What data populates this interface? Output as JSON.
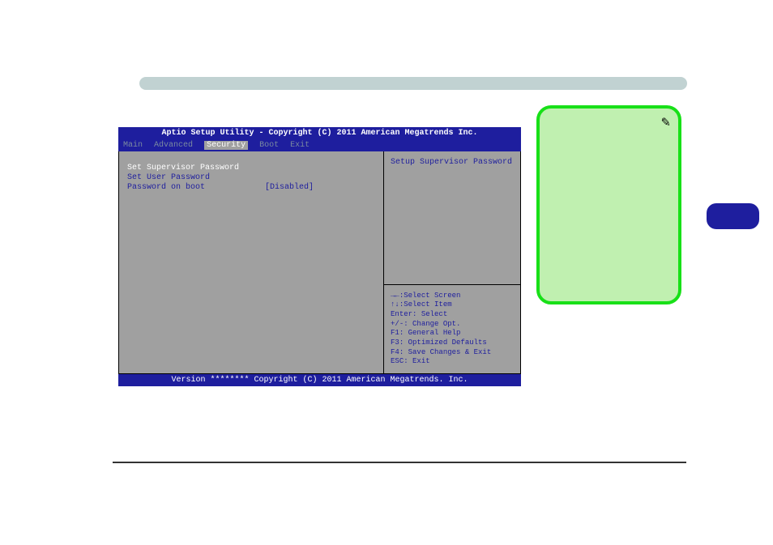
{
  "bios": {
    "title": "Aptio Setup Utility - Copyright (C) 2011 American Megatrends Inc.",
    "menu": {
      "items": [
        "Main",
        "Advanced",
        "Security",
        "Boot",
        "Exit"
      ],
      "active_index": 2
    },
    "settings": {
      "rows": [
        {
          "label": "Set Supervisor Password",
          "value": "",
          "active": true
        },
        {
          "label": "Set User Password",
          "value": "",
          "active": false
        },
        {
          "label": "Password on boot",
          "value": "[Disabled]",
          "active": false
        }
      ]
    },
    "help_text": "Setup Supervisor Password",
    "keys": {
      "l1": "→←:Select Screen",
      "l2": "↑↓:Select Item",
      "l3": "Enter: Select",
      "l4": "+/-: Change Opt.",
      "l5": "F1: General Help",
      "l6": "F3: Optimized Defaults",
      "l7": "F4: Save Changes & Exit",
      "l8": "ESC: Exit"
    },
    "footer": "Version ******** Copyright (C) 2011 American Megatrends. Inc."
  }
}
